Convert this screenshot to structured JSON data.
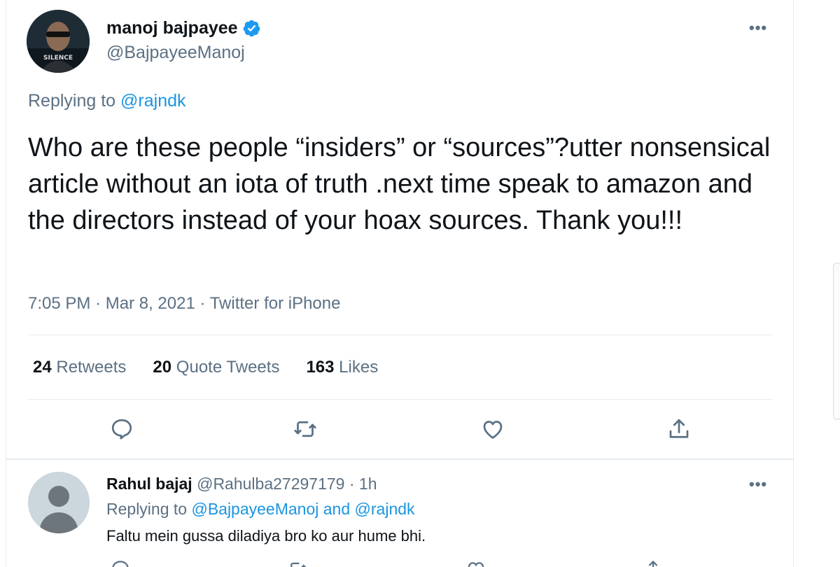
{
  "tweet": {
    "author_name": "manoj bajpayee",
    "author_handle": "@BajpayeeManoj",
    "avatar_text": "SILENCE",
    "replying_prefix": "Replying to",
    "replying_to": "@rajndk",
    "text": "Who are these people “insiders” or “sources”?utter nonsensical article without an iota of truth .next time speak to amazon and the directors instead of your hoax sources. Thank you!!!",
    "time": "7:05 PM",
    "date": "Mar 8, 2021",
    "source": "Twitter for iPhone",
    "dot": "·",
    "more": "•••"
  },
  "stats": {
    "retweets_count": "24",
    "retweets_label": "Retweets",
    "quotes_count": "20",
    "quotes_label": "Quote Tweets",
    "likes_count": "163",
    "likes_label": "Likes"
  },
  "actions": {
    "icons": [
      "reply-icon",
      "retweet-icon",
      "like-icon",
      "share-icon"
    ]
  },
  "reply": {
    "author_name": "Rahul bajaj",
    "author_handle": "@Rahulba27297179",
    "dot": "·",
    "time": "1h",
    "replying_prefix": "Replying to",
    "replying_to_1": "@BajpayeeManoj",
    "and": "and",
    "replying_to_2": "@rajndk",
    "text": "Faltu mein gussa diladiya bro ko aur hume bhi.",
    "more": "•••"
  },
  "colors": {
    "accent": "#1d9bf0",
    "secondary_text": "#5b7083",
    "divider": "#e6ecf0"
  }
}
